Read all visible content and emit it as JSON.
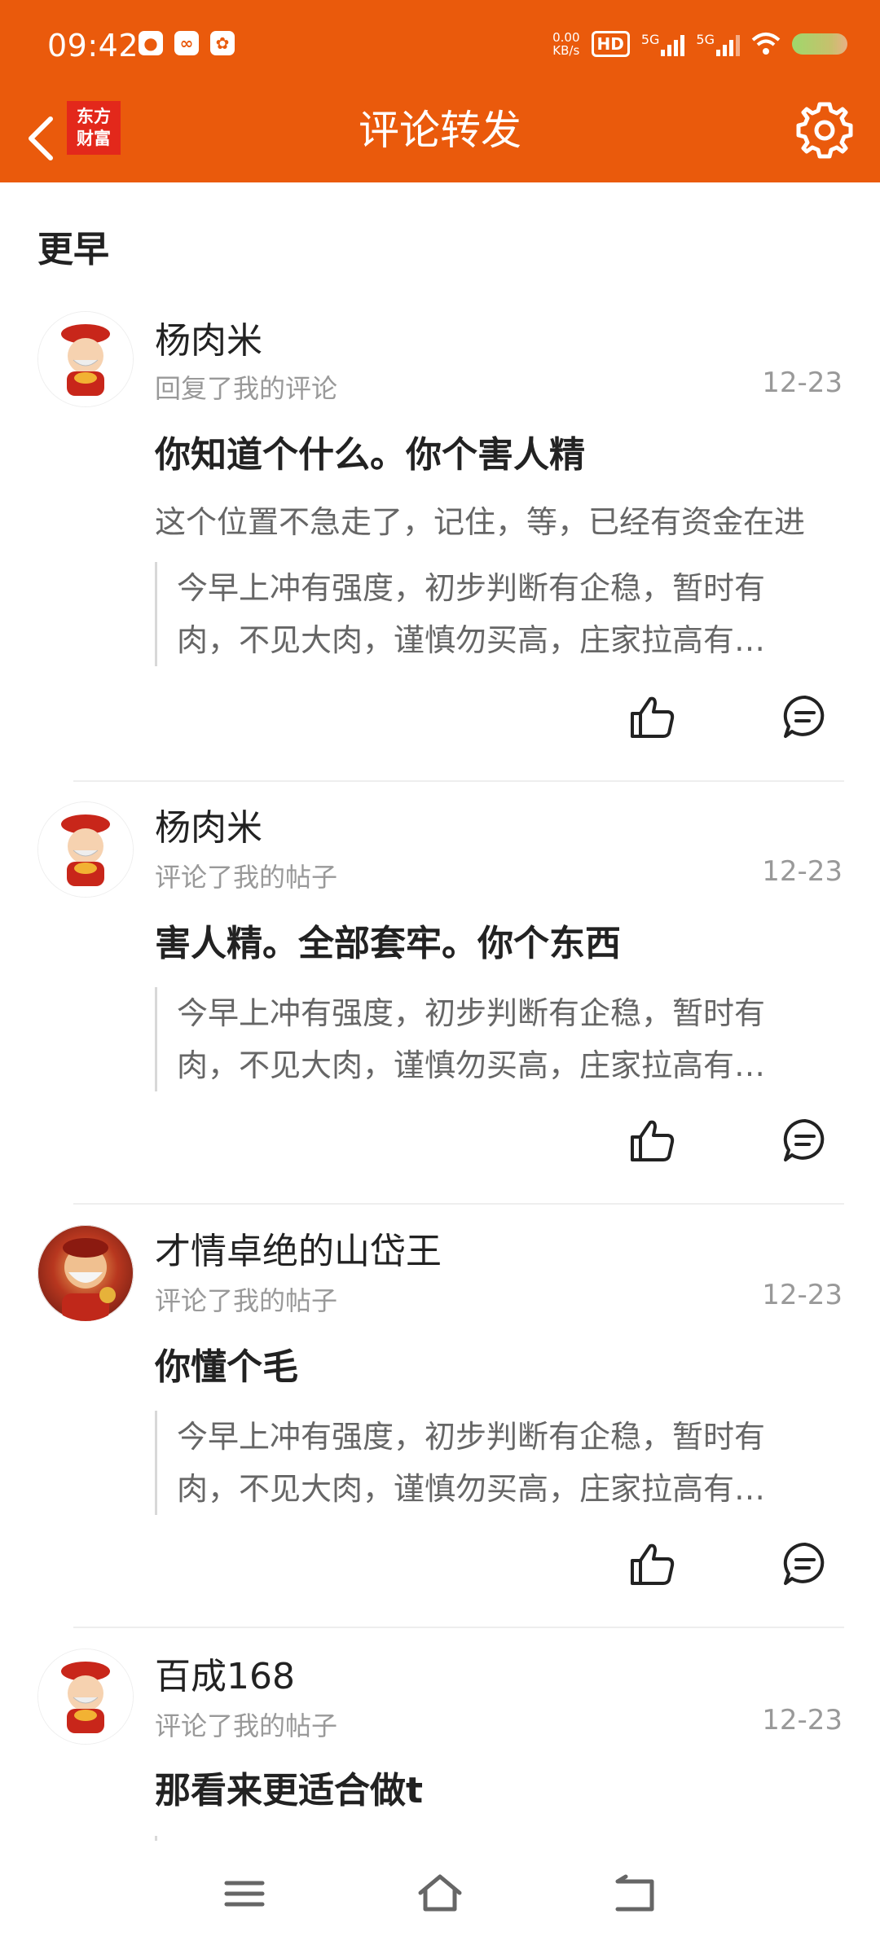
{
  "status_bar": {
    "time": "09:42",
    "net_speed_value": "0.00",
    "net_speed_unit": "KB/s",
    "hd_label": "HD",
    "signal_1_label": "5G",
    "signal_2_label": "5G"
  },
  "header": {
    "logo_line1": "东方",
    "logo_line2": "财富",
    "title": "评论转发"
  },
  "section_label": "更早",
  "items": [
    {
      "username": "杨肉米",
      "action": "回复了我的评论",
      "date": "12-23",
      "content": "你知道个什么。你个害人精",
      "reply": "这个位置不急走了，记住，等，已经有资金在进",
      "quote_line1": "今早上冲有强度，初步判断有企稳，暂时有",
      "quote_line2": "肉，不见大肉，谨慎勿买高，庄家拉高有…"
    },
    {
      "username": "杨肉米",
      "action": "评论了我的帖子",
      "date": "12-23",
      "content": "害人精。全部套牢。你个东西",
      "quote_line1": "今早上冲有强度，初步判断有企稳，暂时有",
      "quote_line2": "肉，不见大肉，谨慎勿买高，庄家拉高有…"
    },
    {
      "username": "才情卓绝的山岱王",
      "action": "评论了我的帖子",
      "date": "12-23",
      "content": "你懂个毛",
      "quote_line1": "今早上冲有强度，初步判断有企稳，暂时有",
      "quote_line2": "肉，不见大肉，谨慎勿买高，庄家拉高有…"
    },
    {
      "username": "百成168",
      "action": "评论了我的帖子",
      "date": "12-23",
      "content": "那看来更适合做t"
    }
  ],
  "colors": {
    "brand": "#EA5A0C",
    "logo_red": "#E3281B",
    "muted_text": "#999999"
  },
  "icons": {
    "back": "back-arrow-icon",
    "settings": "gear-icon",
    "like": "thumbs-up-icon",
    "comment": "comment-bubble-icon",
    "menu": "menu-icon",
    "home": "home-icon",
    "return": "return-icon"
  }
}
